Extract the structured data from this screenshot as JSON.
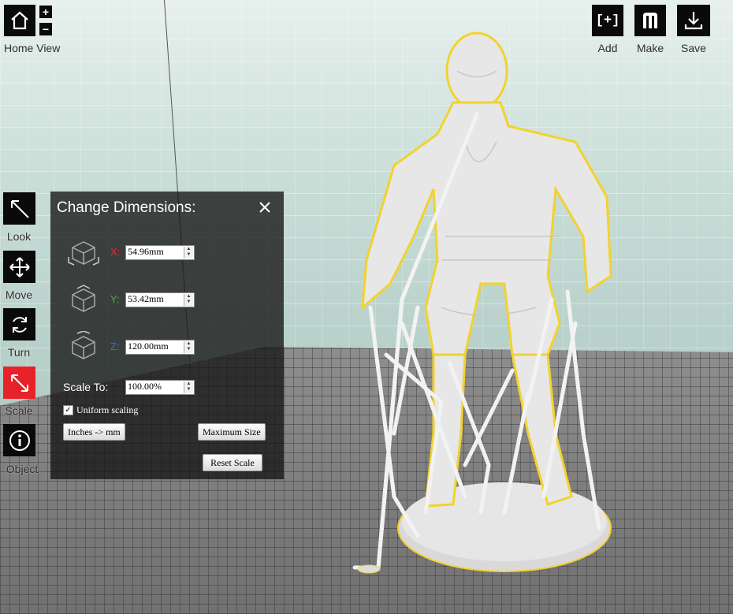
{
  "toolbar_left": {
    "home_label": "Home View",
    "zoom_in": "+",
    "zoom_out": "−",
    "tools": [
      {
        "label": "Look"
      },
      {
        "label": "Move"
      },
      {
        "label": "Turn"
      },
      {
        "label": "Scale"
      },
      {
        "label": "Object"
      }
    ]
  },
  "toolbar_right": {
    "add_label": "Add",
    "add_glyph": "[+]",
    "make_label": "Make",
    "save_label": "Save"
  },
  "dialog": {
    "title": "Change Dimensions:",
    "x_label": "X:",
    "x_value": "54.96mm",
    "y_label": "Y:",
    "y_value": "53.42mm",
    "z_label": "Z:",
    "z_value": "120.00mm",
    "scale_label": "Scale To:",
    "scale_value": "100.00%",
    "uniform_label": "Uniform scaling",
    "uniform_checked": true,
    "inches_button": "Inches -> mm",
    "max_size_button": "Maximum Size",
    "reset_button": "Reset Scale"
  },
  "colors": {
    "active_tool": "#e8222a",
    "x_axis": "#e52b2b",
    "y_axis": "#3fb33f",
    "z_axis": "#2f6fe0",
    "selection_outline": "#f2d22e"
  }
}
